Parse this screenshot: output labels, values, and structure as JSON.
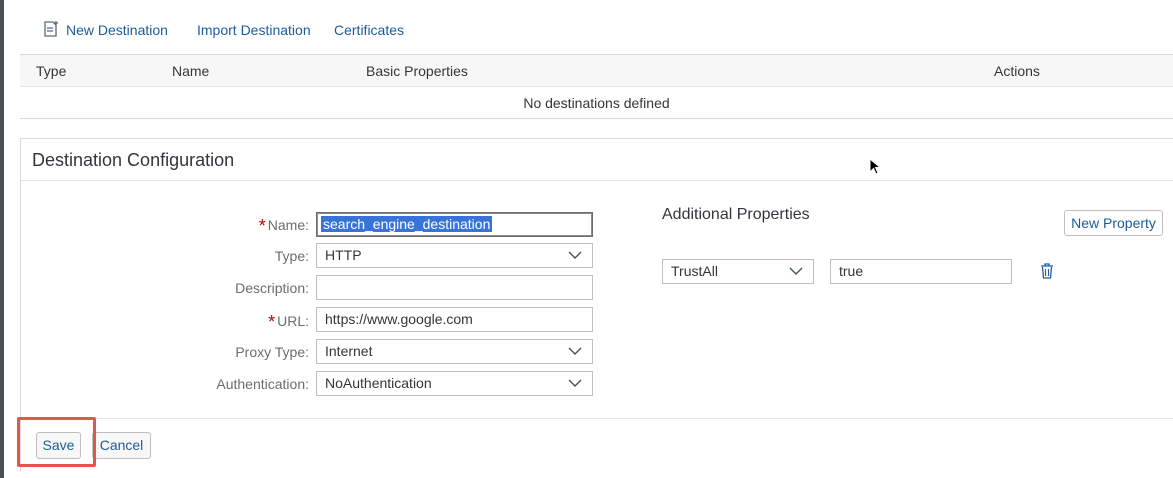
{
  "toolbar": {
    "new_destination": "New Destination",
    "import_destination": "Import Destination",
    "certificates": "Certificates",
    "new_icon": "new-document-icon"
  },
  "table": {
    "columns": [
      "Type",
      "Name",
      "Basic Properties",
      "Actions"
    ],
    "empty_text": "No destinations defined"
  },
  "config": {
    "title": "Destination Configuration",
    "fields": {
      "name": {
        "label": "Name:",
        "value": "search_engine_destination",
        "required": true
      },
      "type": {
        "label": "Type:",
        "value": "HTTP"
      },
      "description": {
        "label": "Description:",
        "value": ""
      },
      "url": {
        "label": "URL:",
        "value": "https://www.google.com",
        "required": true
      },
      "proxy_type": {
        "label": "Proxy Type:",
        "value": "Internet"
      },
      "authentication": {
        "label": "Authentication:",
        "value": "NoAuthentication"
      }
    },
    "additional": {
      "title": "Additional Properties",
      "new_property": "New Property",
      "properties": [
        {
          "key": "TrustAll",
          "value": "true"
        }
      ]
    },
    "footer": {
      "save": "Save",
      "cancel": "Cancel"
    }
  },
  "colors": {
    "link": "#1d5c99",
    "required": "#bb0000",
    "highlight": "#e2574c",
    "selection": "#3874d8"
  }
}
